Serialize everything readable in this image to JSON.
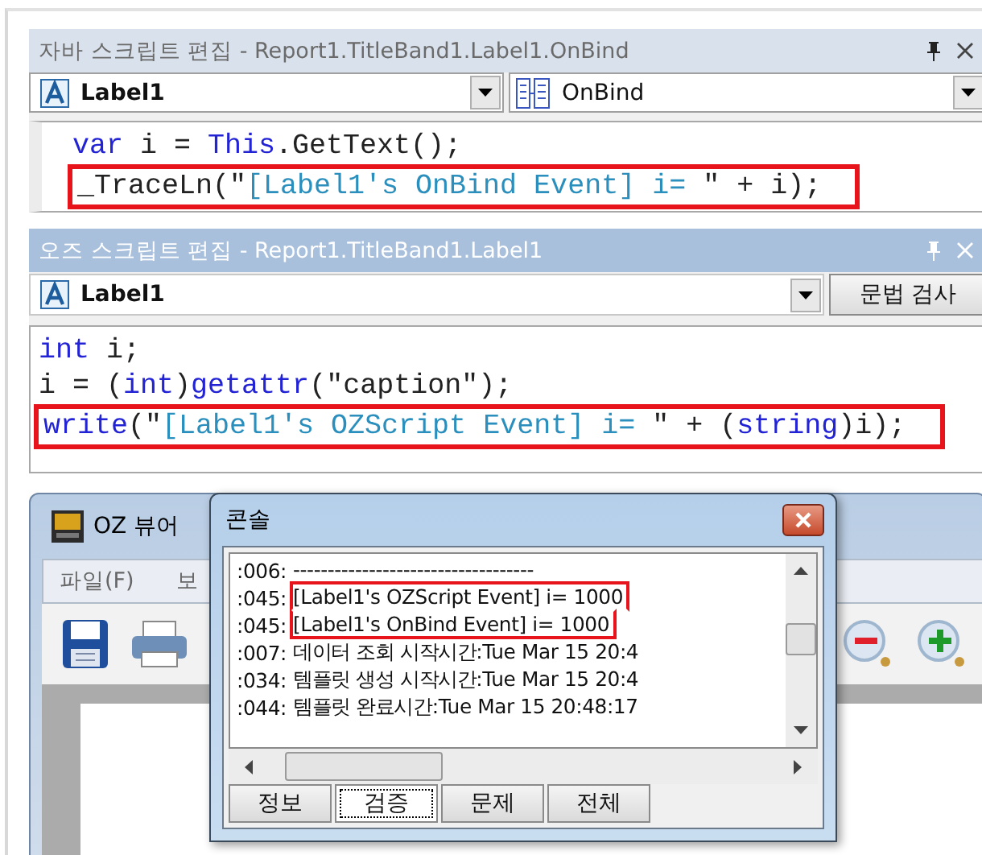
{
  "java_editor": {
    "title": "자바 스크립트 편집 - Report1.TitleBand1.Label1.OnBind",
    "active": false,
    "object_combo": "Label1",
    "event_combo": "OnBind",
    "lines": [
      {
        "boxed": false,
        "tokens": [
          {
            "kind": "keyword",
            "text": "var"
          },
          {
            "kind": "plain",
            "text": " i = "
          },
          {
            "kind": "keyword",
            "text": "This"
          },
          {
            "kind": "plain",
            "text": ".GetText();"
          }
        ]
      },
      {
        "boxed": true,
        "tokens": [
          {
            "kind": "plain",
            "text": "_TraceLn(\""
          },
          {
            "kind": "string",
            "text": "[Label1's OnBind Event] i= "
          },
          {
            "kind": "plain",
            "text": "\" + i);"
          }
        ]
      }
    ]
  },
  "oz_editor": {
    "title": "오즈 스크립트 편집 - Report1.TitleBand1.Label1",
    "active": true,
    "object_combo": "Label1",
    "check_button": "문법 검사",
    "lines": [
      {
        "boxed": false,
        "tokens": [
          {
            "kind": "keyword",
            "text": "int"
          },
          {
            "kind": "plain",
            "text": " i;"
          }
        ]
      },
      {
        "boxed": false,
        "tokens": [
          {
            "kind": "plain",
            "text": "i = ("
          },
          {
            "kind": "keyword",
            "text": "int"
          },
          {
            "kind": "plain",
            "text": ")"
          },
          {
            "kind": "keyword",
            "text": "getattr"
          },
          {
            "kind": "plain",
            "text": "(\"caption\");"
          }
        ]
      },
      {
        "boxed": true,
        "tokens": [
          {
            "kind": "keyword",
            "text": "write"
          },
          {
            "kind": "plain",
            "text": "(\""
          },
          {
            "kind": "string",
            "text": "[Label1's OZScript Event] i= "
          },
          {
            "kind": "plain",
            "text": "\" + ("
          },
          {
            "kind": "keyword",
            "text": "string"
          },
          {
            "kind": "plain",
            "text": ")i);"
          }
        ]
      }
    ]
  },
  "viewer": {
    "title": "OZ 뷰어",
    "menu": [
      "파일(F)",
      "보"
    ]
  },
  "console": {
    "title": "콘솔",
    "lines": [
      {
        "number": ":006:",
        "text": "-----------------------------------",
        "boxed": false
      },
      {
        "number": ":045:",
        "text": "[Label1's OZScript Event] i= 1000",
        "boxed": true
      },
      {
        "number": ":045:",
        "text": "[Label1's OnBind Event] i= 1000",
        "boxed": true
      },
      {
        "number": ":007:",
        "text": "데이터 조회 시작시간:Tue Mar 15 20:4",
        "boxed": false
      },
      {
        "number": ":034:",
        "text": "템플릿 생성 시작시간:Tue Mar 15 20:4",
        "boxed": false
      },
      {
        "number": ":044:",
        "text": "템플릿 완료시간:Tue Mar 15 20:48:17",
        "boxed": false
      }
    ],
    "tabs": [
      {
        "label": "정보",
        "selected": false
      },
      {
        "label": "검증",
        "selected": true
      },
      {
        "label": "문제",
        "selected": false
      },
      {
        "label": "전체",
        "selected": false
      }
    ]
  }
}
